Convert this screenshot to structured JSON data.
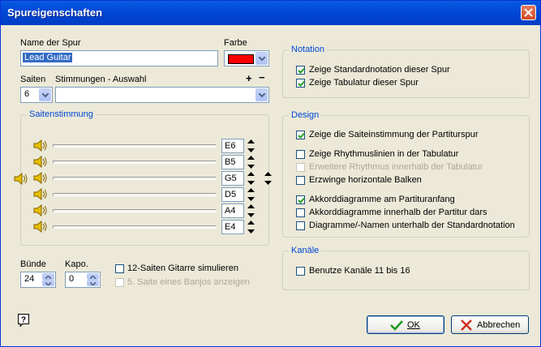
{
  "window": {
    "title": "Spureigenschaften"
  },
  "track": {
    "name_label": "Name der Spur",
    "name_value": "Lead Guitar",
    "color_label": "Farbe",
    "color_value": "#ff0000"
  },
  "strings": {
    "count_label": "Saiten",
    "count_value": "6",
    "tuning_select_label": "Stimmungen - Auswahl",
    "tuning_select_value": "",
    "add_label": "+",
    "remove_label": "−"
  },
  "tuning_group": {
    "label": "Saitenstimmung",
    "strings": [
      {
        "note": "E6"
      },
      {
        "note": "B5"
      },
      {
        "note": "G5"
      },
      {
        "note": "D5"
      },
      {
        "note": "A4"
      },
      {
        "note": "E4"
      }
    ]
  },
  "frets": {
    "label": "Bünde",
    "value": "24"
  },
  "capo": {
    "label": "Kapo.",
    "value": "0"
  },
  "options": {
    "twelve_string": {
      "label": "12-Saiten Gitarre simulieren",
      "checked": false
    },
    "banjo_fifth": {
      "label": "5. Saite eines Banjos anzeigen",
      "checked": false,
      "disabled": true
    }
  },
  "notation": {
    "label": "Notation",
    "items": [
      {
        "label": "Zeige Standardnotation dieser Spur",
        "checked": true
      },
      {
        "label": "Zeige Tabulatur dieser Spur",
        "checked": true
      }
    ]
  },
  "design": {
    "label": "Design",
    "items": [
      {
        "label": "Zeige die Saiteinstimmung der Partiturspur",
        "checked": true,
        "disabled": false
      },
      {
        "label": "Zeige Rhythmuslinien in der Tabulatur",
        "checked": false,
        "disabled": false
      },
      {
        "label": "Erweitere Rhythmus innerhalb der Tabulatur",
        "checked": false,
        "disabled": true
      },
      {
        "label": "Erzwinge horizontale Balken",
        "checked": false,
        "disabled": false
      },
      {
        "label": "Akkorddiagramme am Partituranfang",
        "checked": true,
        "disabled": false
      },
      {
        "label": "Akkorddiagramme innerhalb der Partitur dars",
        "checked": false,
        "disabled": false
      },
      {
        "label": "Diagramme/-Namen unterhalb der Standardnotation",
        "checked": false,
        "disabled": false
      }
    ]
  },
  "channels": {
    "label": "Kanäle",
    "item": {
      "label": "Benutze Kanäle 11 bis 16",
      "checked": false
    }
  },
  "buttons": {
    "ok": "OK",
    "cancel": "Abbrechen"
  },
  "colors": {
    "title_bar": "#0054e3",
    "group_label": "#0046d5",
    "selection": "#316ac5",
    "window_bg": "#ece9d8"
  }
}
